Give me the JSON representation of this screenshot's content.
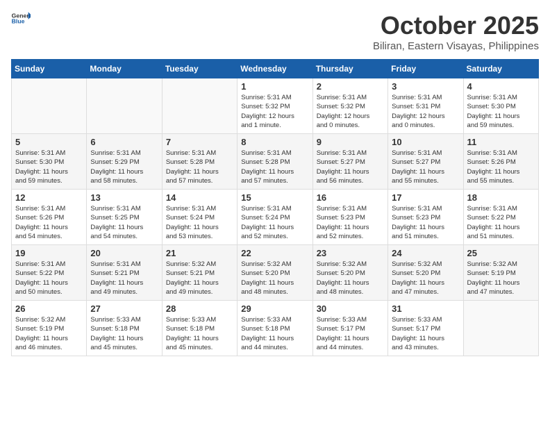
{
  "header": {
    "logo_general": "General",
    "logo_blue": "Blue",
    "month_title": "October 2025",
    "location": "Biliran, Eastern Visayas, Philippines"
  },
  "days_of_week": [
    "Sunday",
    "Monday",
    "Tuesday",
    "Wednesday",
    "Thursday",
    "Friday",
    "Saturday"
  ],
  "weeks": [
    [
      {
        "day": "",
        "info": ""
      },
      {
        "day": "",
        "info": ""
      },
      {
        "day": "",
        "info": ""
      },
      {
        "day": "1",
        "info": "Sunrise: 5:31 AM\nSunset: 5:32 PM\nDaylight: 12 hours\nand 1 minute."
      },
      {
        "day": "2",
        "info": "Sunrise: 5:31 AM\nSunset: 5:32 PM\nDaylight: 12 hours\nand 0 minutes."
      },
      {
        "day": "3",
        "info": "Sunrise: 5:31 AM\nSunset: 5:31 PM\nDaylight: 12 hours\nand 0 minutes."
      },
      {
        "day": "4",
        "info": "Sunrise: 5:31 AM\nSunset: 5:30 PM\nDaylight: 11 hours\nand 59 minutes."
      }
    ],
    [
      {
        "day": "5",
        "info": "Sunrise: 5:31 AM\nSunset: 5:30 PM\nDaylight: 11 hours\nand 59 minutes."
      },
      {
        "day": "6",
        "info": "Sunrise: 5:31 AM\nSunset: 5:29 PM\nDaylight: 11 hours\nand 58 minutes."
      },
      {
        "day": "7",
        "info": "Sunrise: 5:31 AM\nSunset: 5:28 PM\nDaylight: 11 hours\nand 57 minutes."
      },
      {
        "day": "8",
        "info": "Sunrise: 5:31 AM\nSunset: 5:28 PM\nDaylight: 11 hours\nand 57 minutes."
      },
      {
        "day": "9",
        "info": "Sunrise: 5:31 AM\nSunset: 5:27 PM\nDaylight: 11 hours\nand 56 minutes."
      },
      {
        "day": "10",
        "info": "Sunrise: 5:31 AM\nSunset: 5:27 PM\nDaylight: 11 hours\nand 55 minutes."
      },
      {
        "day": "11",
        "info": "Sunrise: 5:31 AM\nSunset: 5:26 PM\nDaylight: 11 hours\nand 55 minutes."
      }
    ],
    [
      {
        "day": "12",
        "info": "Sunrise: 5:31 AM\nSunset: 5:26 PM\nDaylight: 11 hours\nand 54 minutes."
      },
      {
        "day": "13",
        "info": "Sunrise: 5:31 AM\nSunset: 5:25 PM\nDaylight: 11 hours\nand 54 minutes."
      },
      {
        "day": "14",
        "info": "Sunrise: 5:31 AM\nSunset: 5:24 PM\nDaylight: 11 hours\nand 53 minutes."
      },
      {
        "day": "15",
        "info": "Sunrise: 5:31 AM\nSunset: 5:24 PM\nDaylight: 11 hours\nand 52 minutes."
      },
      {
        "day": "16",
        "info": "Sunrise: 5:31 AM\nSunset: 5:23 PM\nDaylight: 11 hours\nand 52 minutes."
      },
      {
        "day": "17",
        "info": "Sunrise: 5:31 AM\nSunset: 5:23 PM\nDaylight: 11 hours\nand 51 minutes."
      },
      {
        "day": "18",
        "info": "Sunrise: 5:31 AM\nSunset: 5:22 PM\nDaylight: 11 hours\nand 51 minutes."
      }
    ],
    [
      {
        "day": "19",
        "info": "Sunrise: 5:31 AM\nSunset: 5:22 PM\nDaylight: 11 hours\nand 50 minutes."
      },
      {
        "day": "20",
        "info": "Sunrise: 5:31 AM\nSunset: 5:21 PM\nDaylight: 11 hours\nand 49 minutes."
      },
      {
        "day": "21",
        "info": "Sunrise: 5:32 AM\nSunset: 5:21 PM\nDaylight: 11 hours\nand 49 minutes."
      },
      {
        "day": "22",
        "info": "Sunrise: 5:32 AM\nSunset: 5:20 PM\nDaylight: 11 hours\nand 48 minutes."
      },
      {
        "day": "23",
        "info": "Sunrise: 5:32 AM\nSunset: 5:20 PM\nDaylight: 11 hours\nand 48 minutes."
      },
      {
        "day": "24",
        "info": "Sunrise: 5:32 AM\nSunset: 5:20 PM\nDaylight: 11 hours\nand 47 minutes."
      },
      {
        "day": "25",
        "info": "Sunrise: 5:32 AM\nSunset: 5:19 PM\nDaylight: 11 hours\nand 47 minutes."
      }
    ],
    [
      {
        "day": "26",
        "info": "Sunrise: 5:32 AM\nSunset: 5:19 PM\nDaylight: 11 hours\nand 46 minutes."
      },
      {
        "day": "27",
        "info": "Sunrise: 5:33 AM\nSunset: 5:18 PM\nDaylight: 11 hours\nand 45 minutes."
      },
      {
        "day": "28",
        "info": "Sunrise: 5:33 AM\nSunset: 5:18 PM\nDaylight: 11 hours\nand 45 minutes."
      },
      {
        "day": "29",
        "info": "Sunrise: 5:33 AM\nSunset: 5:18 PM\nDaylight: 11 hours\nand 44 minutes."
      },
      {
        "day": "30",
        "info": "Sunrise: 5:33 AM\nSunset: 5:17 PM\nDaylight: 11 hours\nand 44 minutes."
      },
      {
        "day": "31",
        "info": "Sunrise: 5:33 AM\nSunset: 5:17 PM\nDaylight: 11 hours\nand 43 minutes."
      },
      {
        "day": "",
        "info": ""
      }
    ]
  ]
}
